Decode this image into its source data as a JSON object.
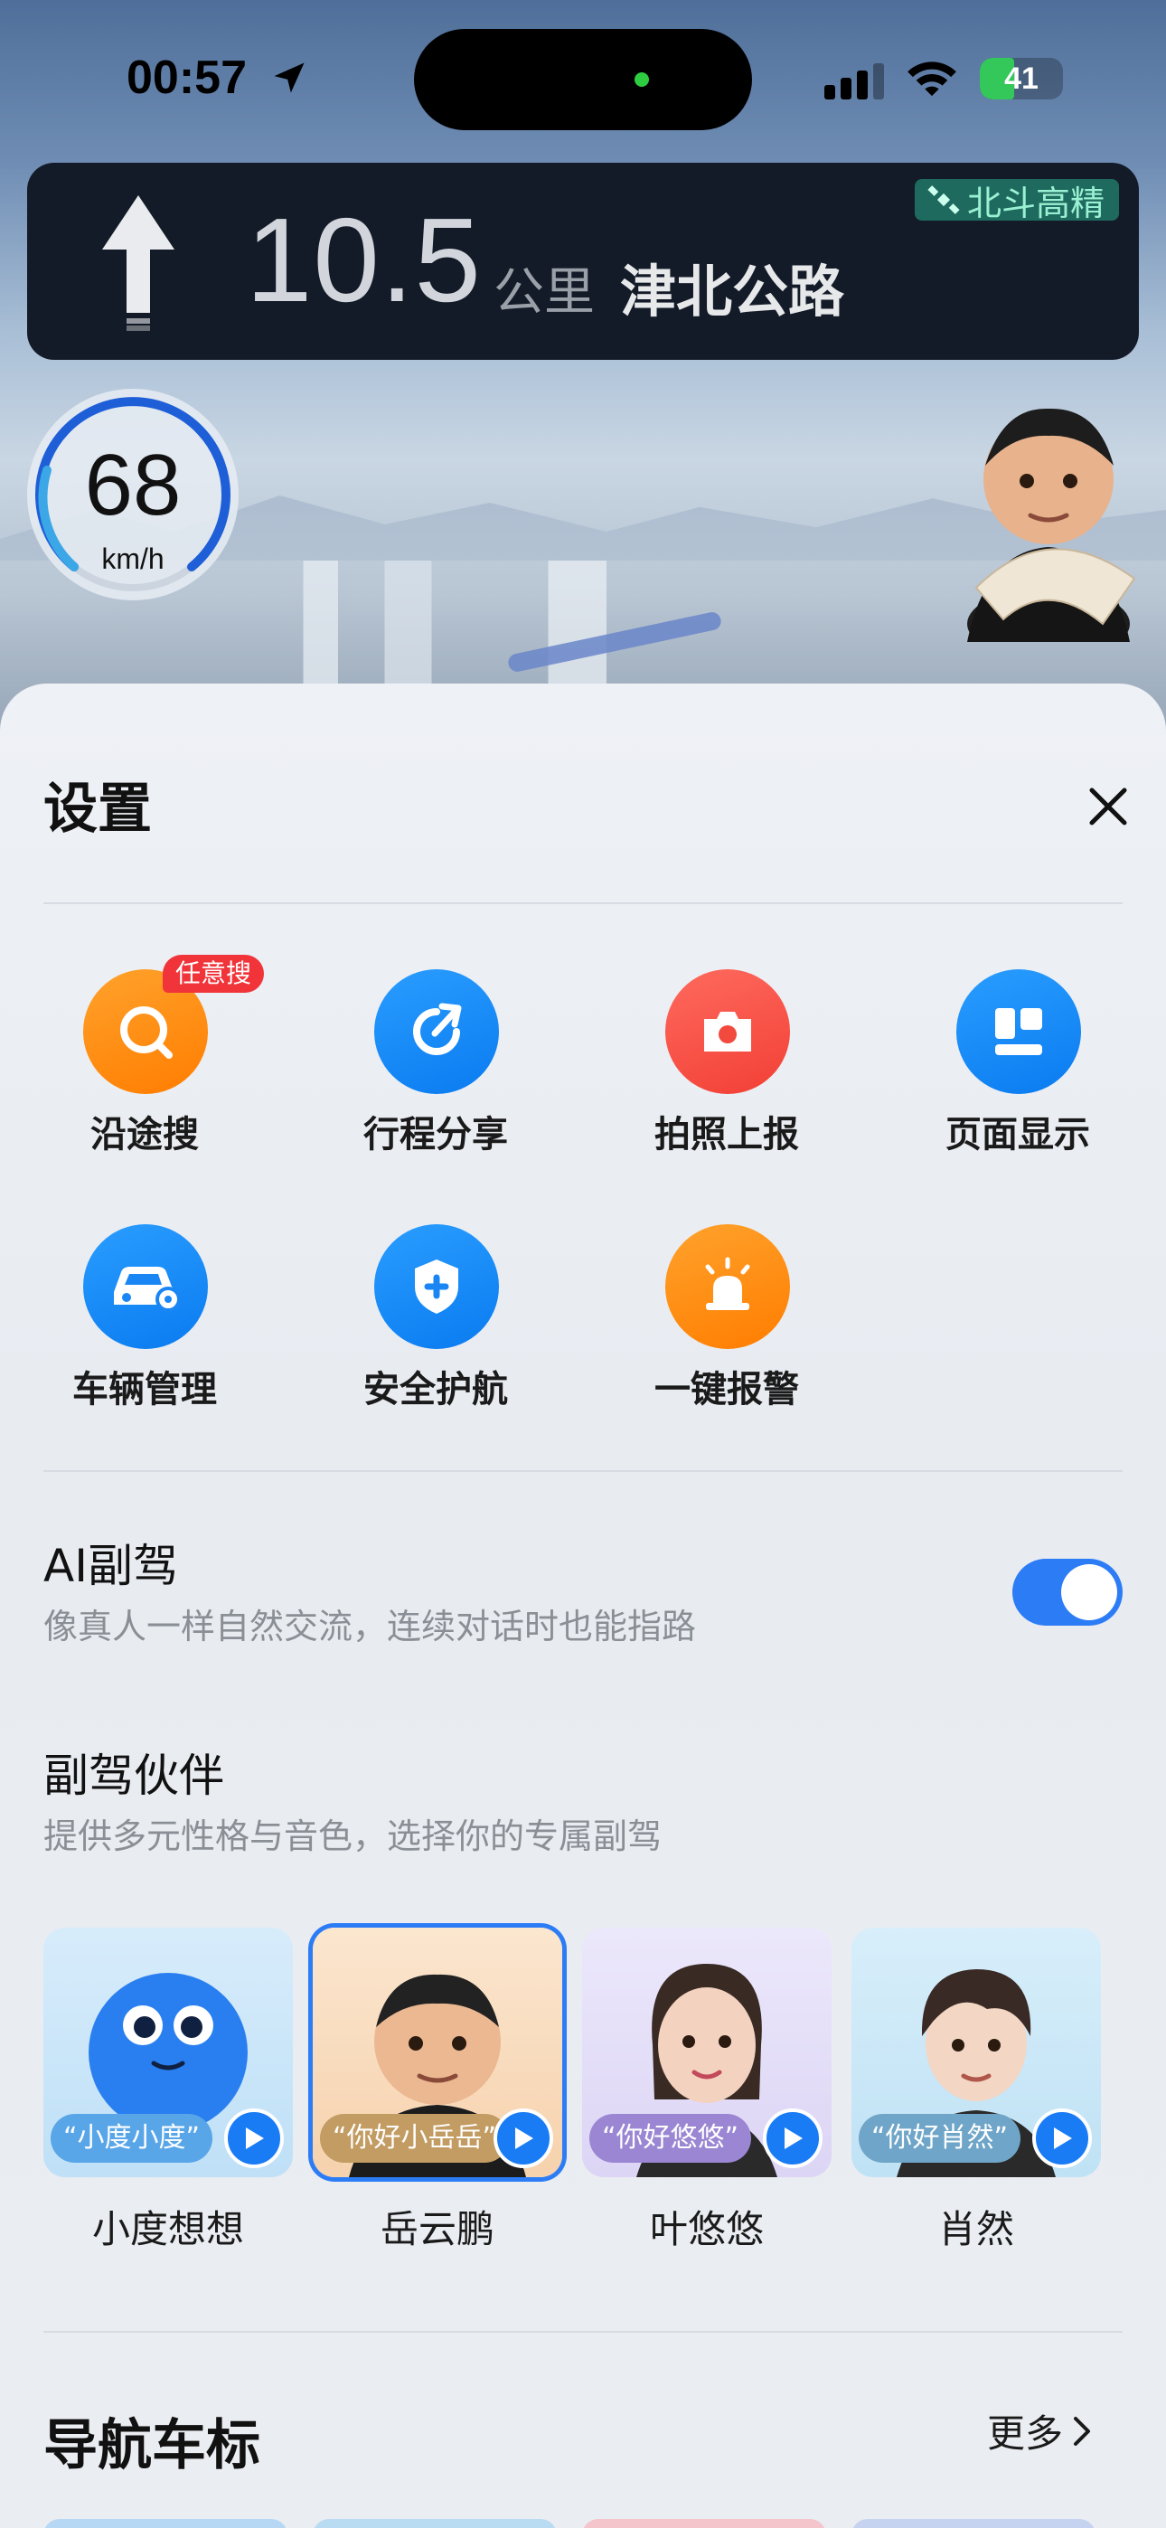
{
  "status_bar": {
    "time": "00:57",
    "battery": "41",
    "battery_level": 0.41
  },
  "navigation": {
    "distance": "10.5",
    "unit": "公里",
    "road": "津北公路",
    "badge": "北斗高精",
    "speed": "68",
    "speed_unit": "km/h"
  },
  "settings": {
    "title": "设置",
    "shortcuts": [
      {
        "label": "沿途搜",
        "icon": "search-icon",
        "badge": "任意搜"
      },
      {
        "label": "行程分享",
        "icon": "share-icon"
      },
      {
        "label": "拍照上报",
        "icon": "camera-icon"
      },
      {
        "label": "页面显示",
        "icon": "layout-icon"
      },
      {
        "label": "车辆管理",
        "icon": "car-icon"
      },
      {
        "label": "安全护航",
        "icon": "shield-icon"
      },
      {
        "label": "一键报警",
        "icon": "alarm-icon"
      }
    ],
    "ai_copilot": {
      "title": "AI副驾",
      "desc": "像真人一样自然交流，连续对话时也能指路",
      "enabled": true
    },
    "partners": {
      "title": "副驾伙伴",
      "desc": "提供多元性格与音色，选择你的专属副驾",
      "items": [
        {
          "name": "小度想想",
          "tag": "“小度小度”",
          "selected": false
        },
        {
          "name": "岳云鹏",
          "tag": "“你好小岳岳”",
          "selected": true
        },
        {
          "name": "叶悠悠",
          "tag": "“你好悠悠”",
          "selected": false
        },
        {
          "name": "肖然",
          "tag": "“你好肖然”",
          "selected": false
        }
      ]
    },
    "nav_icons": {
      "title": "导航车标",
      "more": "更多"
    }
  }
}
